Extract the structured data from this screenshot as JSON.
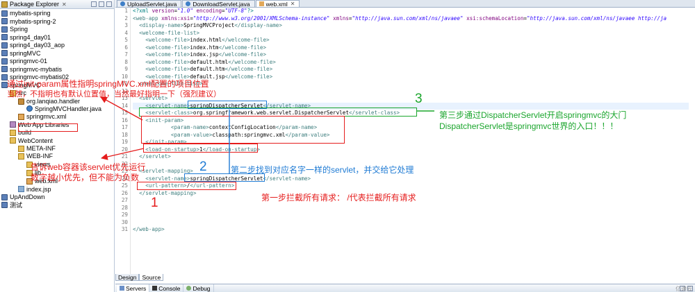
{
  "explorer": {
    "title": "Package Explorer",
    "close": "✕",
    "items": [
      {
        "label": "mybatis-spring",
        "icon": "project"
      },
      {
        "label": "mybatis-spring-2",
        "icon": "project"
      },
      {
        "label": "Spring",
        "icon": "project"
      },
      {
        "label": "spring4_day01",
        "icon": "project"
      },
      {
        "label": "spring4_day03_aop",
        "icon": "project"
      },
      {
        "label": "springMVC",
        "icon": "project"
      },
      {
        "label": "springmvc-01",
        "icon": "project"
      },
      {
        "label": "springmvc-mybatis",
        "icon": "project"
      },
      {
        "label": "springmvc-mybatis02",
        "icon": "project"
      },
      {
        "label": "springMVC",
        "icon": "project"
      },
      {
        "label": "src",
        "icon": "folder"
      },
      {
        "label": "org.lanqiao.handler",
        "icon": "package"
      },
      {
        "label": "SpringMVCHandler.java",
        "icon": "java"
      },
      {
        "label": "springmvc.xml",
        "icon": "xml"
      },
      {
        "label": "Web App Libraries",
        "icon": "lib"
      },
      {
        "label": "build",
        "icon": "folder"
      },
      {
        "label": "WebContent",
        "icon": "folder"
      },
      {
        "label": "META-INF",
        "icon": "folder"
      },
      {
        "label": "WEB-INF",
        "icon": "folder"
      },
      {
        "label": "views",
        "icon": "folder"
      },
      {
        "label": "lib",
        "icon": "folder"
      },
      {
        "label": "web.xml",
        "icon": "xml"
      },
      {
        "label": "index.jsp",
        "icon": "jsp"
      },
      {
        "label": "UpAndDown",
        "icon": "project"
      },
      {
        "label": "测试",
        "icon": "project"
      }
    ]
  },
  "editor": {
    "tabs": [
      {
        "label": "UploadServlet.java",
        "icon": "java"
      },
      {
        "label": "DownloadServlet.java",
        "icon": "java"
      },
      {
        "label": "web.xml",
        "icon": "xml",
        "active": true
      }
    ],
    "tab_close": "✕",
    "line_numbers": [
      "1",
      "2",
      "3",
      "4",
      "5",
      "6",
      "7",
      "8",
      "9",
      "10",
      "11",
      "12",
      "13",
      "14",
      "15",
      "16",
      "17",
      "18",
      "19",
      "20",
      "21",
      "22",
      "23",
      "24",
      "25",
      "26",
      "27",
      "28",
      "29",
      "30",
      "31"
    ],
    "bottom_tabs": [
      "Design",
      "Source"
    ]
  },
  "servers_bar": {
    "tabs": [
      "Servers",
      "Console",
      "Debug"
    ],
    "watermark": "亿速云"
  },
  "annotations": {
    "init_param_note_1": "通过init-param属性指明springMVC.xml配置的项目位置",
    "init_param_note_2": "当然，不指明也有默认位置值，当然最好指明一下（强烈建议）",
    "load_note_1": "告诉web容器该servlet优先运行",
    "load_note_2": "数字越小优先，但不能为负数",
    "step3_num": "3",
    "step3_text_1": "第三步通过DispatcherServlet开启springmvc的大门",
    "step3_text_2": "DispatcherServlet是springmvc世界的入口！！！",
    "step2_num": "2",
    "step2_text": "第二步找到对应名字一样的servlet，并交给它处理",
    "step1_num": "1",
    "step1_text": "第一步拦截所有请求：  /代表拦截所有请求"
  },
  "colors": {
    "red": "#e51c1c",
    "green": "#1aa52c",
    "blue": "#1f7bd4"
  }
}
